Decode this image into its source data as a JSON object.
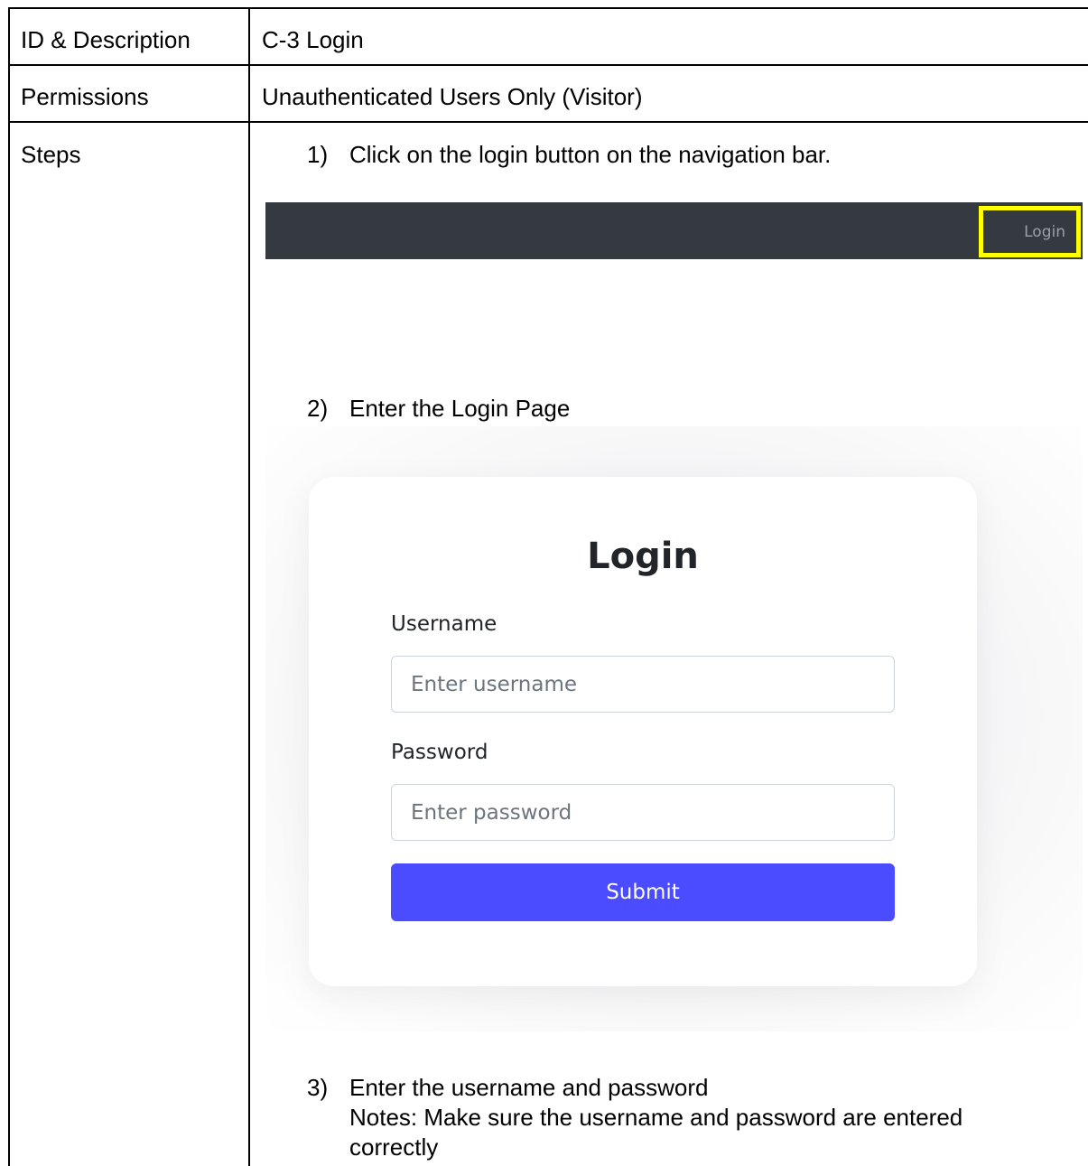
{
  "table": {
    "rows": [
      {
        "label": "ID & Description",
        "value": "C-3 Login"
      },
      {
        "label": "Permissions",
        "value": "Unauthenticated Users Only (Visitor)"
      },
      {
        "label": "Steps"
      }
    ]
  },
  "steps": [
    {
      "number": "1)",
      "text": "Click on the login button on the navigation bar."
    },
    {
      "number": "2)",
      "text": "Enter the Login Page"
    },
    {
      "number": "3)",
      "text": "Enter the username and password",
      "note_line1": "Notes: Make sure the username and password are entered",
      "note_line2": "correctly"
    }
  ],
  "navbar_screenshot": {
    "login_label": "Login",
    "background_color": "#343a40",
    "highlight_color": "#ffff00"
  },
  "login_screenshot": {
    "title": "Login",
    "username_label": "Username",
    "username_placeholder": "Enter username",
    "password_label": "Password",
    "password_placeholder": "Enter password",
    "submit_label": "Submit",
    "submit_color": "#4b4bff"
  }
}
